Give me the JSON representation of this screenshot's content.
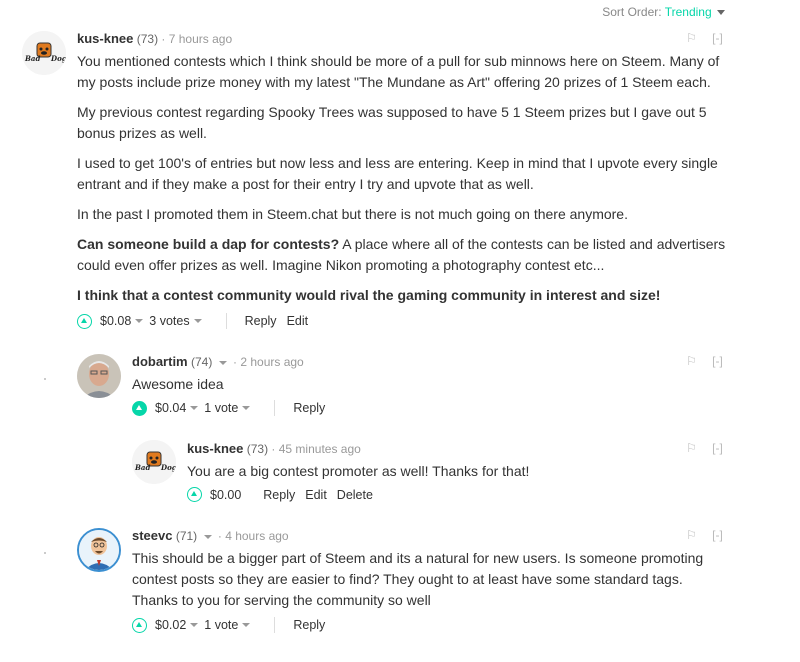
{
  "sort": {
    "label": "Sort Order:",
    "value": "Trending"
  },
  "c1": {
    "author": "kus-knee",
    "rep": "(73)",
    "time": "7 hours ago",
    "collapse": "[-]",
    "p1": "You mentioned contests which I think should be more of a pull for sub minnows here on Steem. Many of my posts include prize money with my latest \"The Mundane as Art\" offering 20 prizes of 1 Steem each.",
    "p2": "My previous contest regarding Spooky Trees was supposed to have 5 1 Steem prizes but I gave out 5 bonus prizes as well.",
    "p3": "I used to get 100's of entries but now less and less are entering. Keep in mind that I upvote every single entrant and if they make a post for their entry I try and upvote that as well.",
    "p4": "In the past I promoted them in Steem.chat but there is not much going on there anymore.",
    "p5_bold": "Can someone build a dap for contests?",
    "p5_rest": " A place where all of the contests can be listed and advertisers could even offer prizes as well. Imagine Nikon promoting a photography contest etc...",
    "p6_bold": "I think that a contest community would rival the gaming community in interest and size!",
    "payout": "$0.08",
    "votes": "3 votes",
    "reply": "Reply",
    "edit": "Edit"
  },
  "c2": {
    "author": "dobartim",
    "rep": "(74)",
    "time": "2 hours ago",
    "collapse": "[-]",
    "text": "Awesome idea",
    "payout": "$0.04",
    "votes": "1 vote",
    "reply": "Reply"
  },
  "c3": {
    "author": "kus-knee",
    "rep": "(73)",
    "time": "45 minutes ago",
    "collapse": "[-]",
    "text": "You are a big contest promoter as well! Thanks for that!",
    "payout": "$0.00",
    "reply": "Reply",
    "edit": "Edit",
    "delete": "Delete"
  },
  "c4": {
    "author": "steevc",
    "rep": "(71)",
    "time": "4 hours ago",
    "collapse": "[-]",
    "text": "This should be a bigger part of Steem and its a natural for new users. Is someone promoting contest posts so they are easier to find? They ought to at least have some standard tags. Thanks to you for serving the community so well",
    "payout": "$0.02",
    "votes": "1 vote",
    "reply": "Reply"
  },
  "avatar_logo_text": "Bad Dog",
  "colors": {
    "accent": "#06d6a9"
  }
}
